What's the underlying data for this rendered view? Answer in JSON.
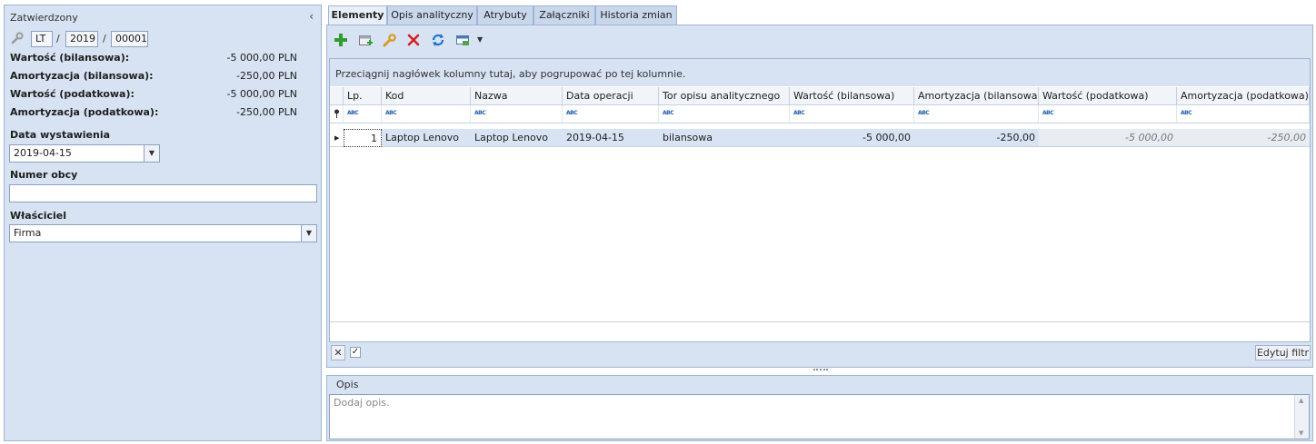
{
  "left": {
    "status": "Zatwierdzony",
    "doc": {
      "series": "LT",
      "year": "2019",
      "number": "00001",
      "sep": "/"
    },
    "values": [
      {
        "label": "Wartość (bilansowa):",
        "value": "-5 000,00 PLN"
      },
      {
        "label": "Amortyzacja (bilansowa):",
        "value": "-250,00 PLN"
      },
      {
        "label": "Wartość (podatkowa):",
        "value": "-5 000,00 PLN"
      },
      {
        "label": "Amortyzacja (podatkowa):",
        "value": "-250,00 PLN"
      }
    ],
    "date_label": "Data wystawienia",
    "date_value": "2019-04-15",
    "foreign_label": "Numer obcy",
    "foreign_value": "",
    "owner_label": "Właściciel",
    "owner_value": "Firma"
  },
  "tabs": [
    "Elementy",
    "Opis analityczny",
    "Atrybuty",
    "Załączniki",
    "Historia zmian"
  ],
  "grid": {
    "group_hint": "Przeciągnij nagłówek kolumny tutaj, aby pogrupować po tej kolumnie.",
    "filter_icon_text": "ABC",
    "columns": [
      "Lp.",
      "Kod",
      "Nazwa",
      "Data operacji",
      "Tor opisu analitycznego",
      "Wartość (bilansowa)",
      "Amortyzacja (bilansowa)",
      "Wartość (podatkowa)",
      "Amortyzacja (podatkowa)"
    ],
    "rows": [
      [
        "1",
        "Laptop Lenovo",
        "Laptop Lenovo",
        "2019-04-15",
        "bilansowa",
        "-5 000,00",
        "-250,00",
        "-5 000,00",
        "-250,00"
      ]
    ],
    "edit_filter": "Edytuj filtr"
  },
  "opis": {
    "label": "Opis",
    "placeholder": "Dodaj opis."
  },
  "colors": {
    "panel": "#d7e2f2",
    "border": "#9fb4d2",
    "selected_row": "#d8e4f4",
    "add_green": "#2e9d2e",
    "delete_red": "#d42020"
  }
}
